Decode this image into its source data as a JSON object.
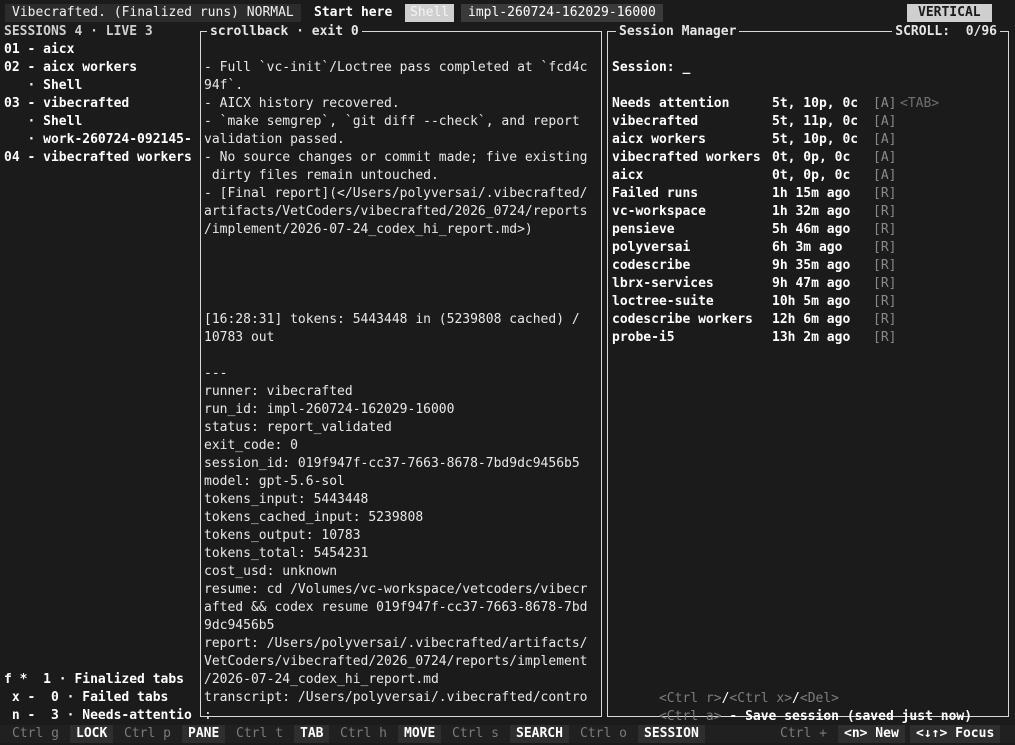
{
  "topbar": {
    "title": "Vibecrafted. (Finalized runs) NORMAL",
    "start_here": "Start here",
    "tab_shell": "Shell",
    "tab_impl": "impl-260724-162029-16000",
    "vertical": "VERTICAL"
  },
  "sessions": {
    "header": "SESSIONS 4 · LIVE 3",
    "items": [
      "01 - aicx",
      "02 - aicx workers",
      "   · Shell",
      "03 - vibecrafted",
      "   · Shell",
      "   · work-260724-092145-",
      "04 - vibecrafted workers"
    ]
  },
  "scrollback": {
    "title": "scrollback · exit 0",
    "lines": [
      "- Full `vc-init`/Loctree pass completed at `fcd4c",
      "94f`.",
      "- AICX history recovered.",
      "- `make semgrep`, `git diff --check`, and report",
      "validation passed.",
      "- No source changes or commit made; five existing",
      " dirty files remain untouched.",
      "- [Final report](</Users/polyversai/.vibecrafted/",
      "artifacts/VetCoders/vibecrafted/2026_0724/reports",
      "/implement/2026-07-24_codex_hi_report.md>)",
      "",
      "",
      "",
      "",
      "[16:28:31] tokens: 5443448 in (5239808 cached) /",
      "10783 out",
      "",
      "---",
      "runner: vibecrafted",
      "run_id: impl-260724-162029-16000",
      "status: report_validated",
      "exit_code: 0",
      "session_id: 019f947f-cc37-7663-8678-7bd9dc9456b5",
      "model: gpt-5.6-sol",
      "tokens_input: 5443448",
      "tokens_cached_input: 5239808",
      "tokens_output: 10783",
      "tokens_total: 5454231",
      "cost_usd: unknown",
      "resume: cd /Volumes/vc-workspace/vetcoders/vibecr",
      "afted && codex resume 019f947f-cc37-7663-8678-7bd",
      "9dc9456b5",
      "report: /Users/polyversai/.vibecrafted/artifacts/",
      "VetCoders/vibecrafted/2026_0724/reports/implement",
      "/2026-07-24_codex_hi_report.md",
      "transcript: /Users/polyversai/.vibecrafted/contro",
      ":"
    ]
  },
  "session_manager": {
    "title": "Session Manager",
    "scroll_label": "SCROLL:  0/96",
    "prompt": "Session: _",
    "tab_hint": "<TAB>",
    "rows": [
      {
        "name": "Needs attention",
        "stat": "5t, 10p, 0c",
        "tag": "[A]"
      },
      {
        "name": "vibecrafted",
        "stat": "5t, 11p, 0c",
        "tag": "[A]"
      },
      {
        "name": "aicx workers",
        "stat": "5t, 10p, 0c",
        "tag": "[A]"
      },
      {
        "name": "vibecrafted workers",
        "stat": "0t, 0p, 0c",
        "tag": "[A]"
      },
      {
        "name": "aicx",
        "stat": "0t, 0p, 0c",
        "tag": "[A]"
      },
      {
        "name": "Failed runs",
        "stat": "1h 15m ago",
        "tag": "[R]"
      },
      {
        "name": "vc-workspace",
        "stat": "1h 32m ago",
        "tag": "[R]"
      },
      {
        "name": "pensieve",
        "stat": "5h 46m ago",
        "tag": "[R]"
      },
      {
        "name": "polyversai",
        "stat": "6h 3m ago",
        "tag": "[R]"
      },
      {
        "name": "codescribe",
        "stat": "9h 35m ago",
        "tag": "[R]"
      },
      {
        "name": "lbrx-services",
        "stat": "9h 47m ago",
        "tag": "[R]"
      },
      {
        "name": "loctree-suite",
        "stat": "10h 5m ago",
        "tag": "[R]"
      },
      {
        "name": "codescribe workers",
        "stat": "12h 6m ago",
        "tag": "[R]"
      },
      {
        "name": "probe-i5",
        "stat": "13h 2m ago",
        "tag": "[R]"
      }
    ],
    "footer_keys_1": "<Ctrl r>",
    "footer_sep_1": "/",
    "footer_keys_2": "<Ctrl x>",
    "footer_sep_2": "/",
    "footer_keys_3": "<Del>",
    "footer_keys_4": "<Ctrl a>",
    "footer_action": " - Save session (saved just now)"
  },
  "tabcounts": [
    "f *  1 · Finalized tabs",
    " x -  0 · Failed tabs",
    " n -  3 · Needs-attentio"
  ],
  "bottombar": {
    "k1": "Ctrl g",
    "v1": "LOCK",
    "k2": "Ctrl p",
    "v2": "PANE",
    "k3": "Ctrl t",
    "v3": "TAB",
    "k4": "Ctrl h",
    "v4": "MOVE",
    "k5": "Ctrl s",
    "v5": "SEARCH",
    "k6": "Ctrl o",
    "v6": "SESSION",
    "k7": "Ctrl +",
    "v7": "<n> New",
    "v8": "<↓↑> Focus"
  }
}
